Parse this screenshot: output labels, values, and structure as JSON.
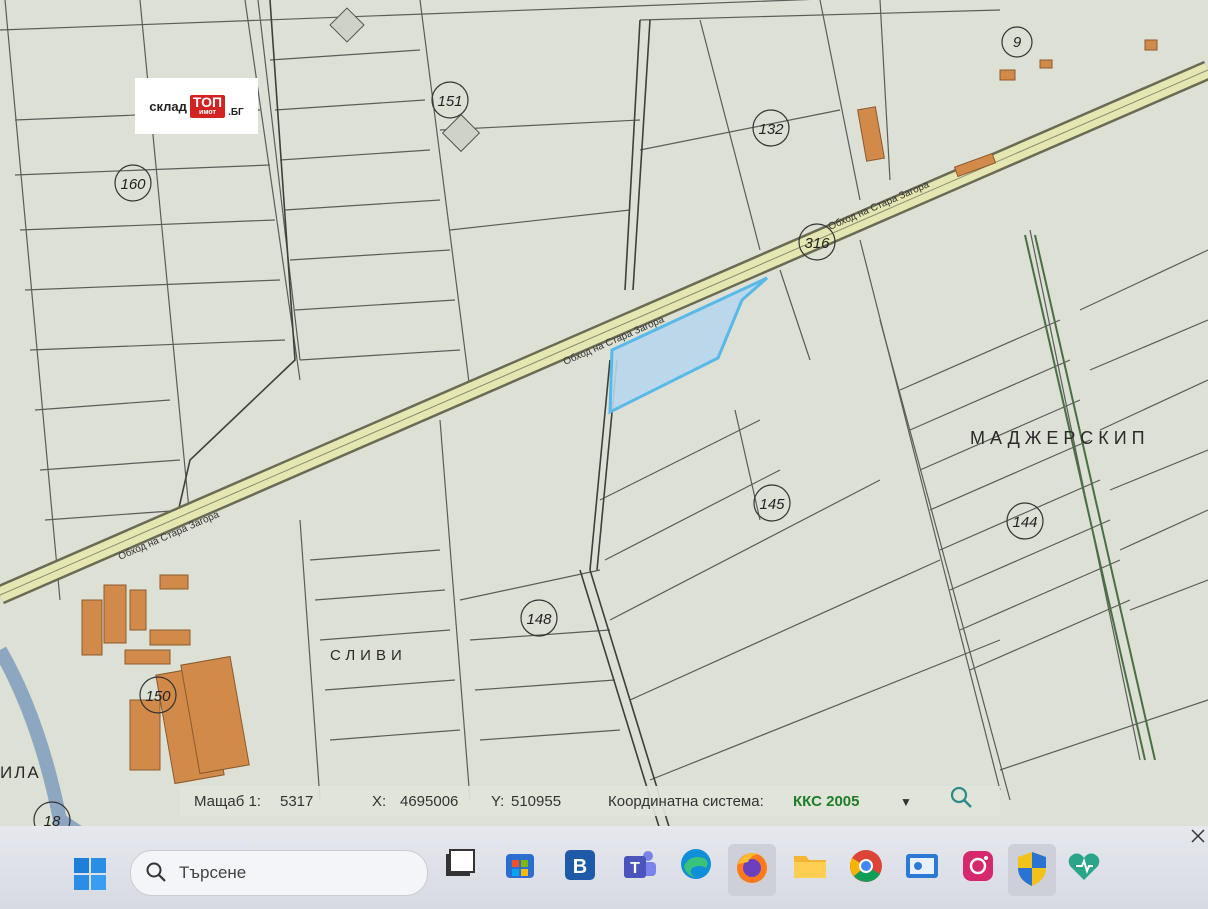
{
  "logo": {
    "part1": "склад",
    "part2": "ТОП",
    "part2_sub": "имот",
    "part3": ".БГ"
  },
  "map": {
    "parcel_numbers": [
      "151",
      "160",
      "132",
      "316",
      "145",
      "144",
      "148",
      "150",
      "9",
      "18"
    ],
    "area_labels": {
      "madzherski": "МАДЖЕРСКИП",
      "slivi": "СЛИВИ",
      "ila": "ИЛА"
    },
    "road_label": "Обход на Стара Загора",
    "highlight_color": "#58b9e8"
  },
  "status": {
    "scale_label": "Мащаб 1:",
    "scale_value": "5317",
    "x_label": "X:",
    "x_value": "4695006",
    "y_label": "Y:",
    "y_value": "510955",
    "crs_label": "Координатна система:",
    "crs_value": "ККС 2005",
    "dropdown_glyph": "▼"
  },
  "taskbar": {
    "search_placeholder": "Търсене",
    "apps": [
      "widgets-icon",
      "store-icon",
      "b-app-icon",
      "teams-icon",
      "edge-icon",
      "firefox-icon",
      "explorer-icon",
      "chrome-icon",
      "photos-icon",
      "instagram-icon",
      "security-icon",
      "heart-app-icon"
    ]
  }
}
